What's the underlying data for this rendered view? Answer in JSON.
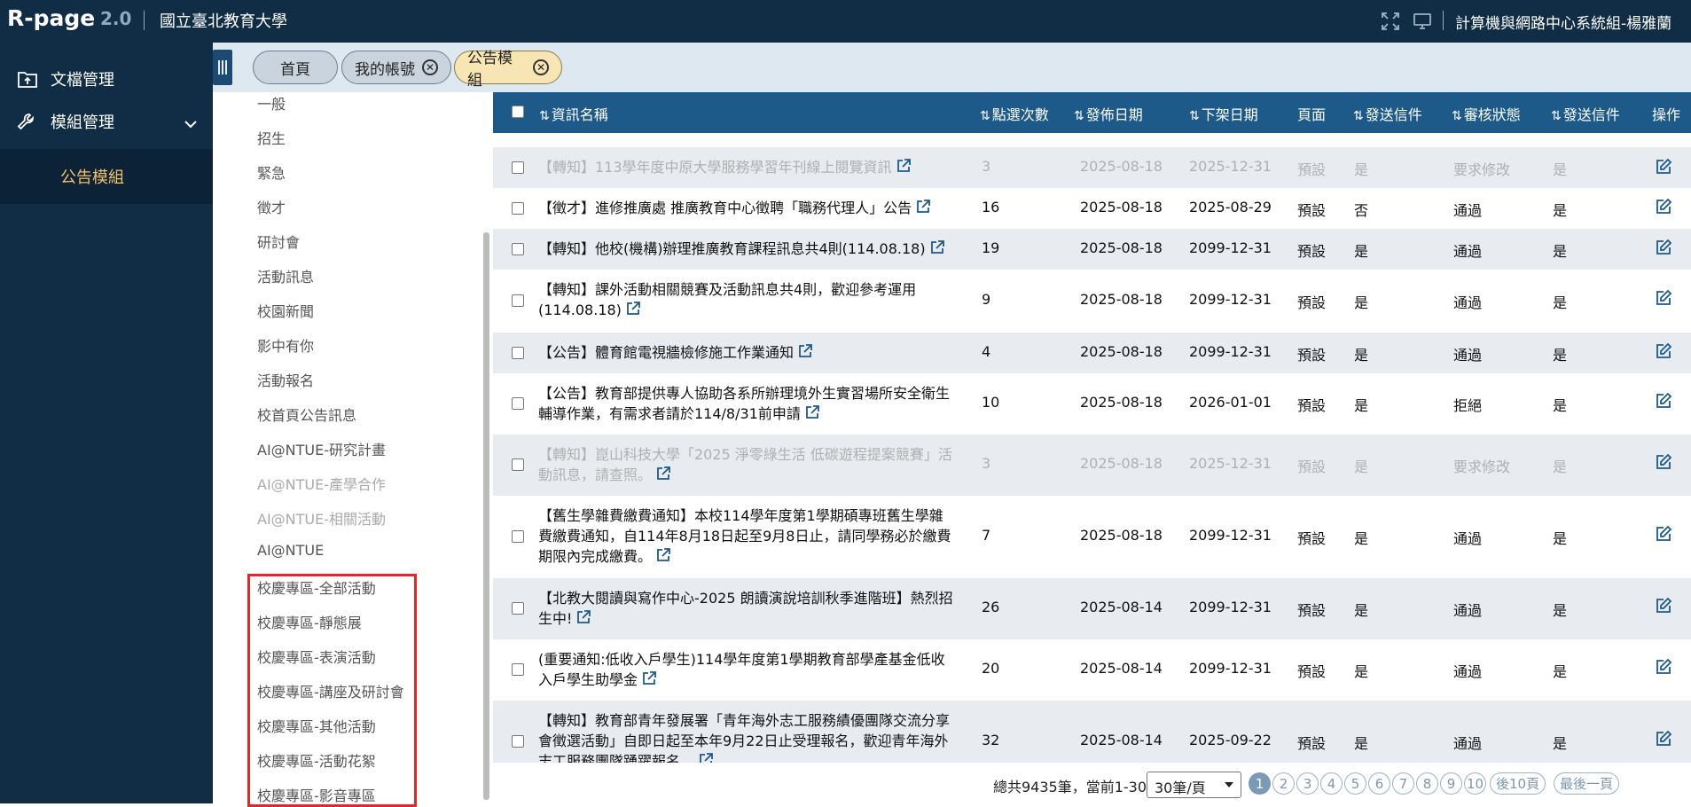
{
  "header": {
    "logo": "R-page",
    "version": "2.0",
    "school": "國立臺北教育大學",
    "user": "計算機與網路中心系統組-楊雅蘭"
  },
  "sidebar": {
    "items": [
      {
        "label": "文檔管理",
        "icon": "file-upload-icon"
      },
      {
        "label": "模組管理",
        "icon": "wrench-icon"
      }
    ],
    "sub_item": "公告模組"
  },
  "tabs": [
    {
      "label": "首頁",
      "closable": false
    },
    {
      "label": "我的帳號",
      "closable": true
    },
    {
      "label": "公告模組",
      "closable": true,
      "active": true
    }
  ],
  "categories": [
    {
      "label": "一般",
      "dim": false
    },
    {
      "label": "招生",
      "dim": false
    },
    {
      "label": "緊急",
      "dim": false
    },
    {
      "label": "徵才",
      "dim": false
    },
    {
      "label": "研討會",
      "dim": false
    },
    {
      "label": "活動訊息",
      "dim": false
    },
    {
      "label": "校園新聞",
      "dim": false
    },
    {
      "label": "影中有你",
      "dim": false
    },
    {
      "label": "活動報名",
      "dim": false
    },
    {
      "label": "校首頁公告訊息",
      "dim": false
    },
    {
      "label": "AI@NTUE-研究計畫",
      "dim": false
    },
    {
      "label": "AI@NTUE-產學合作",
      "dim": true
    },
    {
      "label": "AI@NTUE-相關活動",
      "dim": true
    },
    {
      "label": "AI@NTUE",
      "dim": false
    },
    {
      "label": "校慶專區-全部活動",
      "dim": false
    },
    {
      "label": "校慶專區-靜態展",
      "dim": false
    },
    {
      "label": "校慶專區-表演活動",
      "dim": false
    },
    {
      "label": "校慶專區-講座及研討會",
      "dim": false
    },
    {
      "label": "校慶專區-其他活動",
      "dim": false
    },
    {
      "label": "校慶專區-活動花絮",
      "dim": false
    },
    {
      "label": "校慶專區-影音專區",
      "dim": false
    }
  ],
  "table": {
    "headers": {
      "title": "資訊名稱",
      "clicks": "點選次數",
      "publish": "發佈日期",
      "unpublish": "下架日期",
      "page": "頁面",
      "send_mail": "發送信件",
      "review": "審核狀態",
      "send_mail2": "發送信件",
      "action": "操作"
    },
    "rows": [
      {
        "title": "【轉知】113學年度中原大學服務學習年刊線上閱覽資訊",
        "clicks": "3",
        "publish": "2025-08-18",
        "unpublish": "2025-12-31",
        "page": "預設",
        "mail": "是",
        "review": "要求修改",
        "mail2": "是",
        "dim": true
      },
      {
        "title": "【徵才】進修推廣處 推廣教育中心徵聘「職務代理人」公告",
        "clicks": "16",
        "publish": "2025-08-18",
        "unpublish": "2025-08-29",
        "page": "預設",
        "mail": "否",
        "review": "通過",
        "mail2": "是",
        "dim": false
      },
      {
        "title": "【轉知】他校(機構)辦理推廣教育課程訊息共4則(114.08.18)",
        "clicks": "19",
        "publish": "2025-08-18",
        "unpublish": "2099-12-31",
        "page": "預設",
        "mail": "是",
        "review": "通過",
        "mail2": "是",
        "dim": false
      },
      {
        "title": "【轉知】課外活動相關競賽及活動訊息共4則，歡迎參考運用(114.08.18)",
        "clicks": "9",
        "publish": "2025-08-18",
        "unpublish": "2099-12-31",
        "page": "預設",
        "mail": "是",
        "review": "通過",
        "mail2": "是",
        "dim": false
      },
      {
        "title": "【公告】體育館電視牆檢修施工作業通知",
        "clicks": "4",
        "publish": "2025-08-18",
        "unpublish": "2099-12-31",
        "page": "預設",
        "mail": "是",
        "review": "通過",
        "mail2": "是",
        "dim": false
      },
      {
        "title": "【公告】教育部提供專人協助各系所辦理境外生實習場所安全衛生輔導作業，有需求者請於114/8/31前申請",
        "clicks": "10",
        "publish": "2025-08-18",
        "unpublish": "2026-01-01",
        "page": "預設",
        "mail": "是",
        "review": "拒絕",
        "mail2": "是",
        "dim": false
      },
      {
        "title": "【轉知】崑山科技大學「2025 淨零綠生活 低碳遊程提案競賽」活動訊息，請查照。",
        "clicks": "3",
        "publish": "2025-08-18",
        "unpublish": "2025-12-31",
        "page": "預設",
        "mail": "是",
        "review": "要求修改",
        "mail2": "是",
        "dim": true
      },
      {
        "title": "【舊生學雜費繳費通知】本校114學年度第1學期碩專班舊生學雜費繳費通知，自114年8月18日起至9月8日止，請同學務必於繳費期限內完成繳費。",
        "clicks": "7",
        "publish": "2025-08-18",
        "unpublish": "2099-12-31",
        "page": "預設",
        "mail": "是",
        "review": "通過",
        "mail2": "是",
        "dim": false
      },
      {
        "title": "【北教大閱讀與寫作中心-2025 朗讀演說培訓秋季進階班】熱烈招生中!",
        "clicks": "26",
        "publish": "2025-08-14",
        "unpublish": "2099-12-31",
        "page": "預設",
        "mail": "是",
        "review": "通過",
        "mail2": "是",
        "dim": false
      },
      {
        "title": "(重要通知:低收入戶學生)114學年度第1學期教育部學產基金低收入戶學生助學金",
        "clicks": "20",
        "publish": "2025-08-14",
        "unpublish": "2099-12-31",
        "page": "預設",
        "mail": "是",
        "review": "通過",
        "mail2": "是",
        "dim": false
      },
      {
        "title": "【轉知】教育部青年發展署「青年海外志工服務績優團隊交流分享會徵選活動」自即日起至本年9月22日止受理報名，歡迎青年海外志工服務團隊踴躍報名。",
        "clicks": "32",
        "publish": "2025-08-14",
        "unpublish": "2025-09-22",
        "page": "預設",
        "mail": "是",
        "review": "通過",
        "mail2": "是",
        "dim": false
      }
    ]
  },
  "pager": {
    "total": "總共9435筆，當前1-30",
    "per_page": "30筆/頁",
    "pages": [
      "1",
      "2",
      "3",
      "4",
      "5",
      "6",
      "7",
      "8",
      "9",
      "10"
    ],
    "next10": "後10頁",
    "last": "最後一頁"
  },
  "colors": {
    "topbar": "#112d45",
    "thead": "#1d5a8a",
    "accent": "#f3c26b",
    "highlight": "#e8232a"
  }
}
